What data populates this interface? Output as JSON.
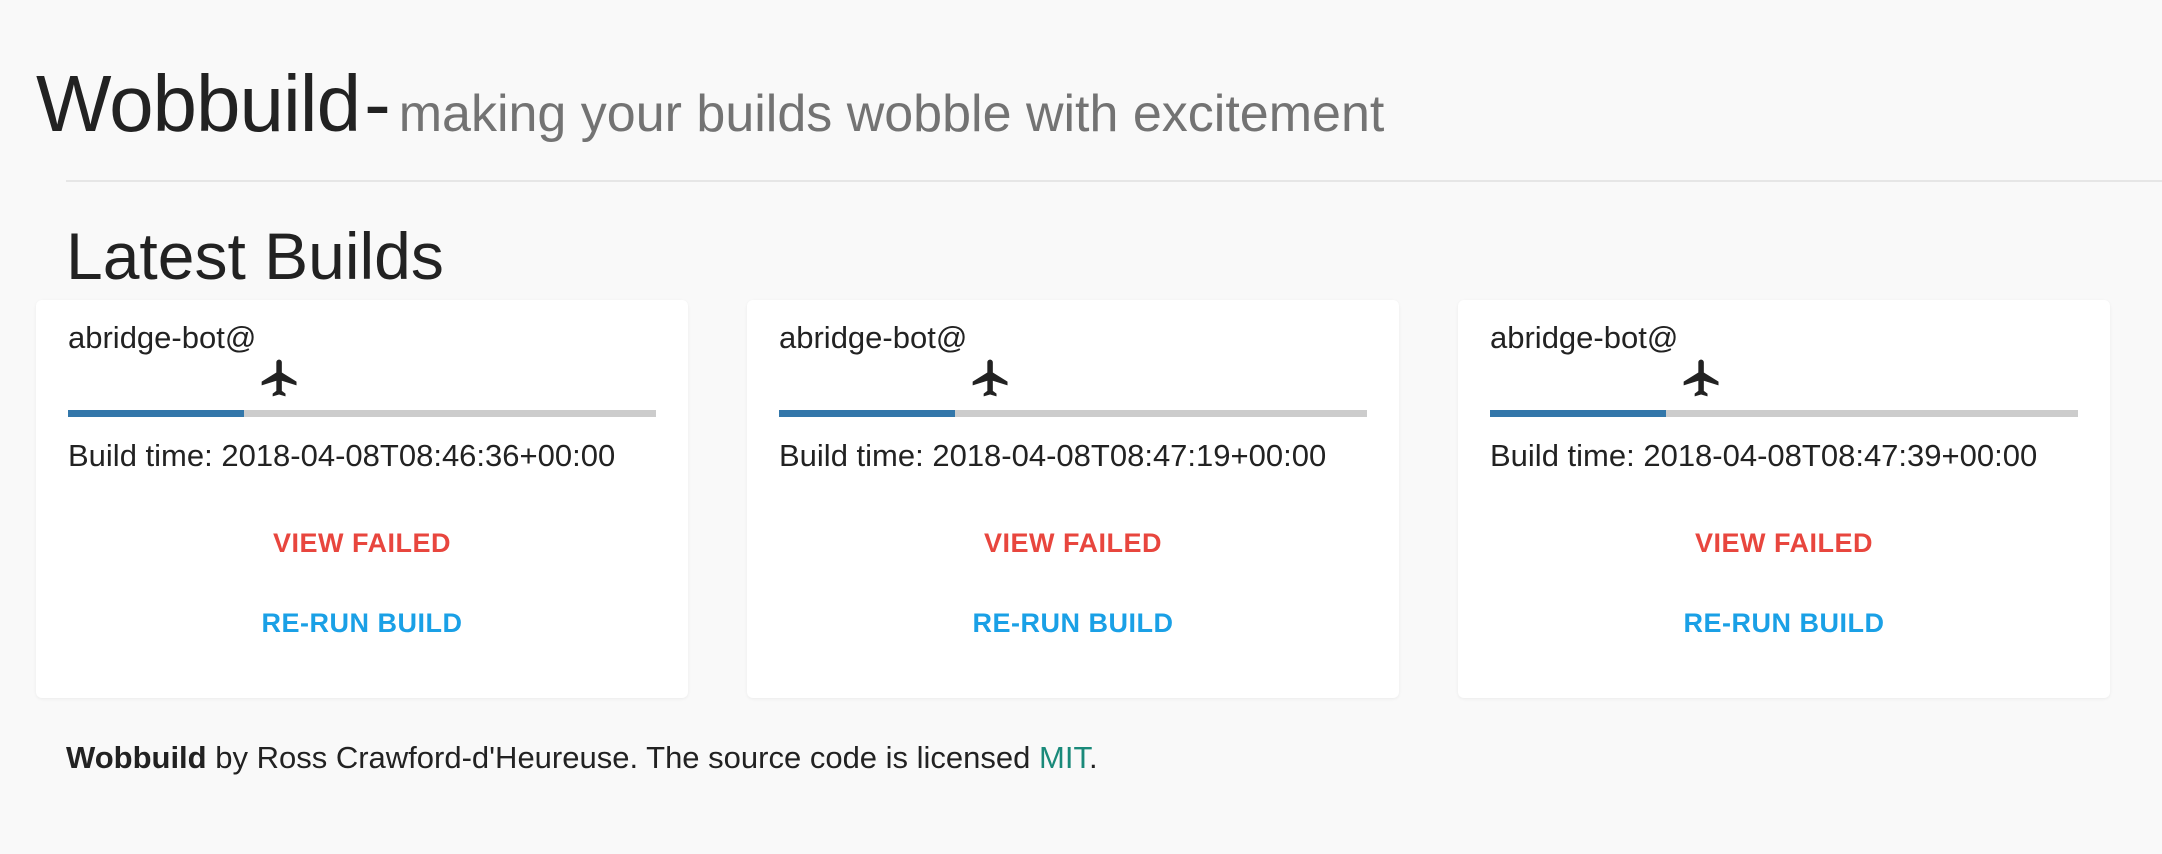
{
  "header": {
    "brand": "Wobbuild",
    "separator": "-",
    "tagline": "making your builds wobble with excitement"
  },
  "section": {
    "title": "Latest Builds"
  },
  "builds": [
    {
      "user": "abridge-bot@",
      "icon": "airplane-icon",
      "progress": 0.3,
      "build_time": "Build time: 2018-04-08T08:46:36+00:00",
      "view_failed_label": "VIEW FAILED",
      "rerun_label": "RE-RUN BUILD"
    },
    {
      "user": "abridge-bot@",
      "icon": "airplane-icon",
      "progress": 0.3,
      "build_time": "Build time: 2018-04-08T08:47:19+00:00",
      "view_failed_label": "VIEW FAILED",
      "rerun_label": "RE-RUN BUILD"
    },
    {
      "user": "abridge-bot@",
      "icon": "airplane-icon",
      "progress": 0.3,
      "build_time": "Build time: 2018-04-08T08:47:39+00:00",
      "view_failed_label": "VIEW FAILED",
      "rerun_label": "RE-RUN BUILD"
    }
  ],
  "footer": {
    "brand": "Wobbuild",
    "text": " by Ross Crawford-d'Heureuse. The source code is licensed ",
    "license_link": "MIT",
    "end": "."
  },
  "colors": {
    "progress_fill": "#3377aa",
    "progress_track": "#cccccc",
    "failed": "#e8463e",
    "rerun": "#1aa0e6",
    "link": "#1a8a7a"
  }
}
